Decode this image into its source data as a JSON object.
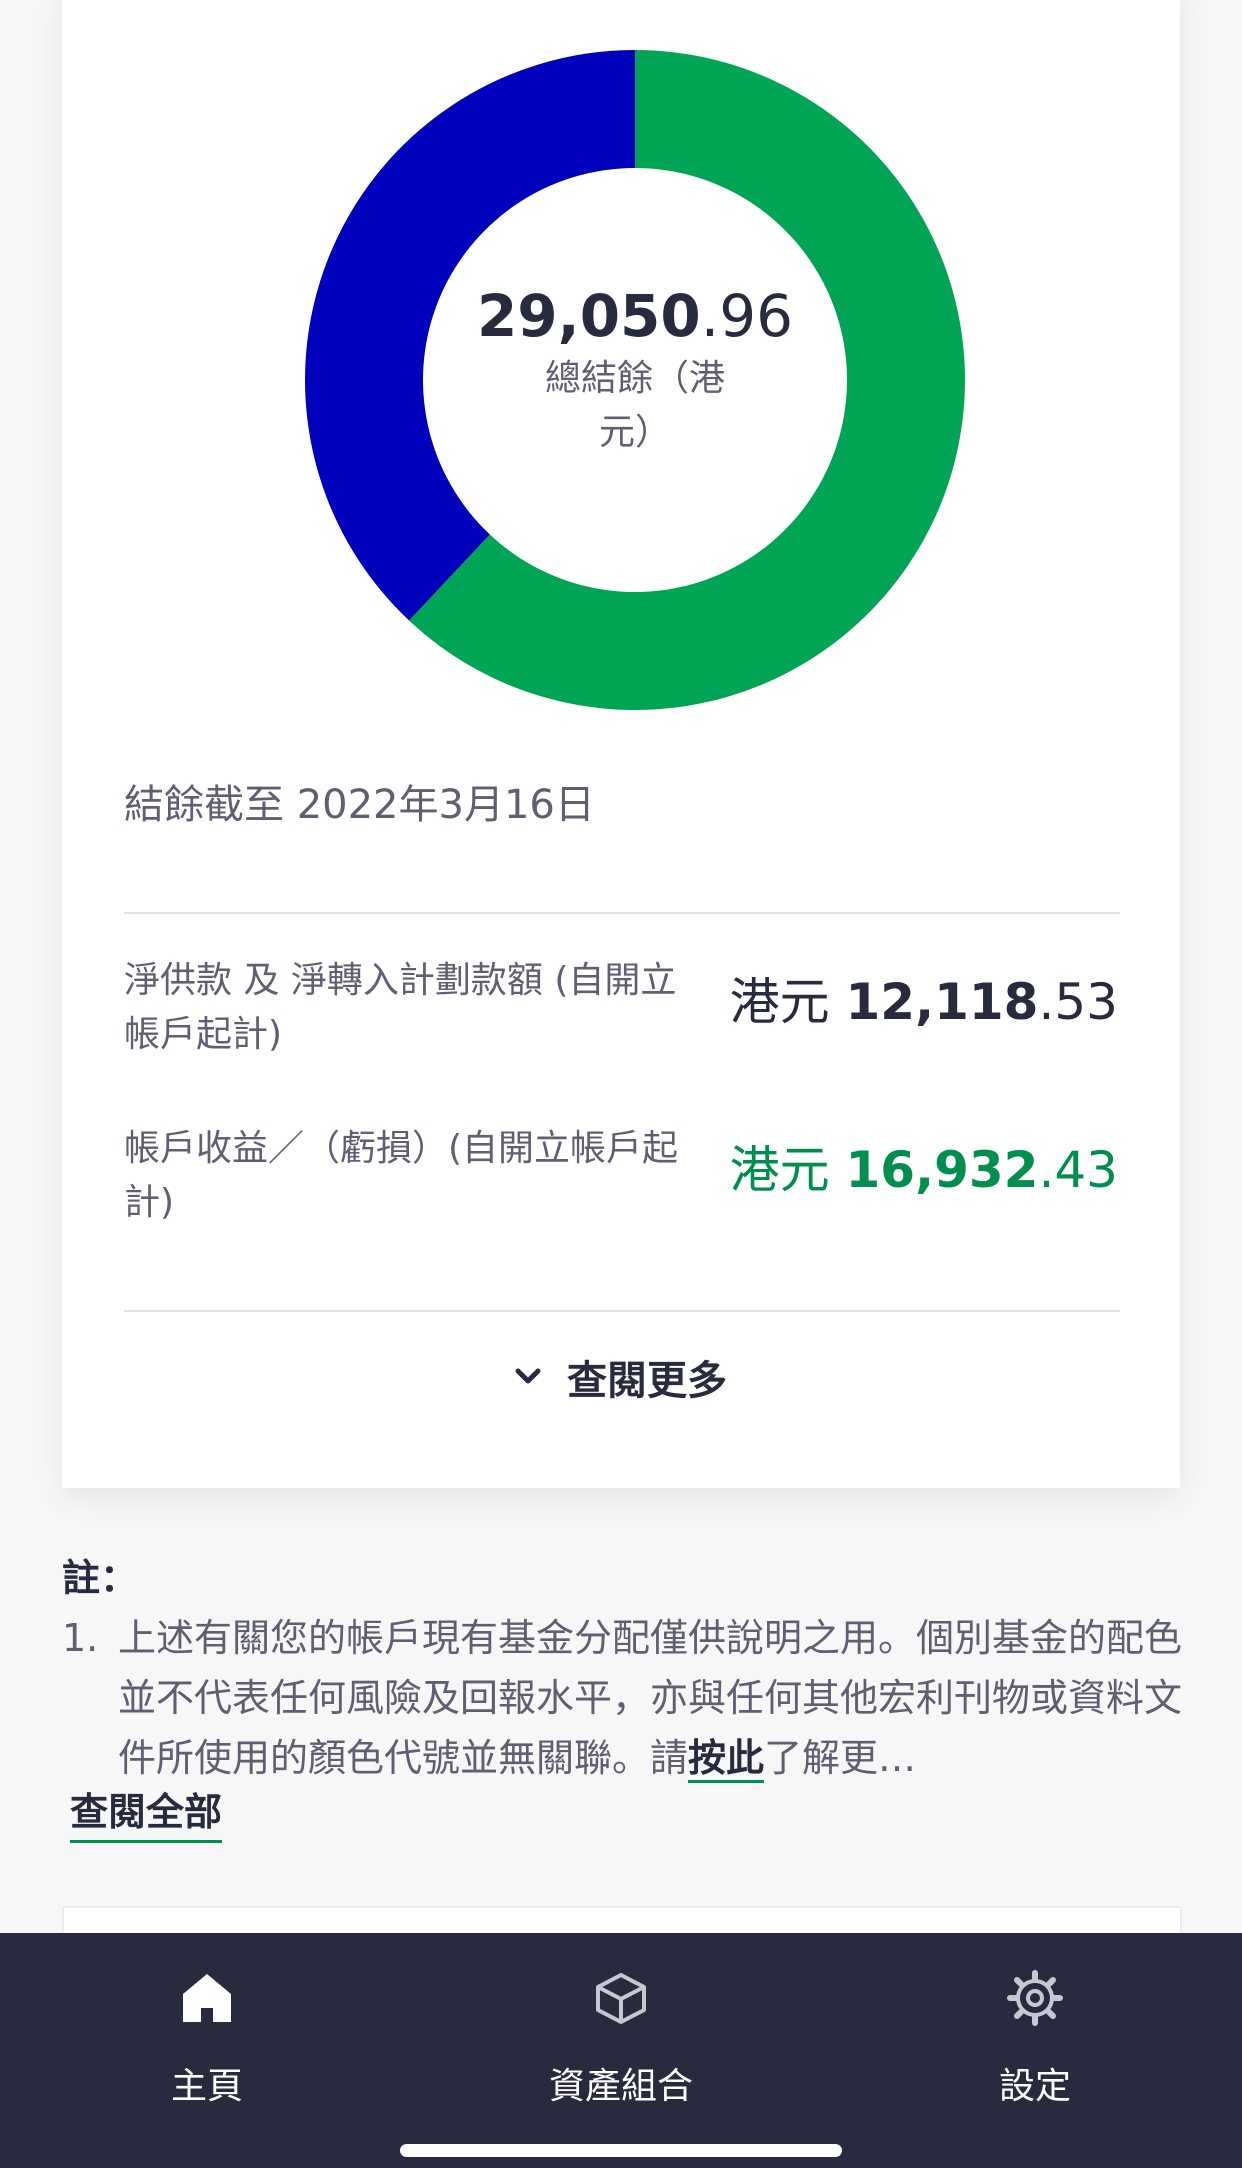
{
  "chart_data": {
    "type": "pie",
    "categories": [
      "",
      ""
    ],
    "values": [
      62,
      38
    ],
    "colors": [
      "#00a455",
      "#0000bc"
    ],
    "donut": true
  },
  "summary": {
    "total_int": "29,050",
    "total_dec": ".96",
    "total_label": "總結餘（港元）",
    "as_of": "結餘截至 2022年3月16日"
  },
  "rows": [
    {
      "label": "淨供款 及 淨轉入計劃款額 (自開立帳戶起計)",
      "currency": "港元",
      "int": "12,118",
      "dec": ".53"
    },
    {
      "label": "帳戶收益／（虧損）(自開立帳戶起計)",
      "currency": "港元",
      "int": "16,932",
      "dec": ".43"
    }
  ],
  "view_more_label": "查閱更多",
  "notes": {
    "title": "註：",
    "number": "1.",
    "text_before": "上述有關您的帳戶現有基金分配僅供說明之用。個別基金的配色並不代表任何風險及回報水平，亦與任何其他宏利刊物或資料文件所使用的顏色代號並無關聯。請",
    "link_label": "按此",
    "text_after": "了解更…",
    "view_all_label": "查閱全部"
  },
  "tabbar": {
    "items": [
      {
        "label": "主頁",
        "icon": "home-icon"
      },
      {
        "label": "資產組合",
        "icon": "cube-icon"
      },
      {
        "label": "設定",
        "icon": "gear-icon"
      }
    ]
  },
  "colors": {
    "accent": "#008e4f",
    "text_primary": "#282b3e",
    "text_secondary": "#5e6072",
    "tabbar_bg": "#282b3e"
  }
}
